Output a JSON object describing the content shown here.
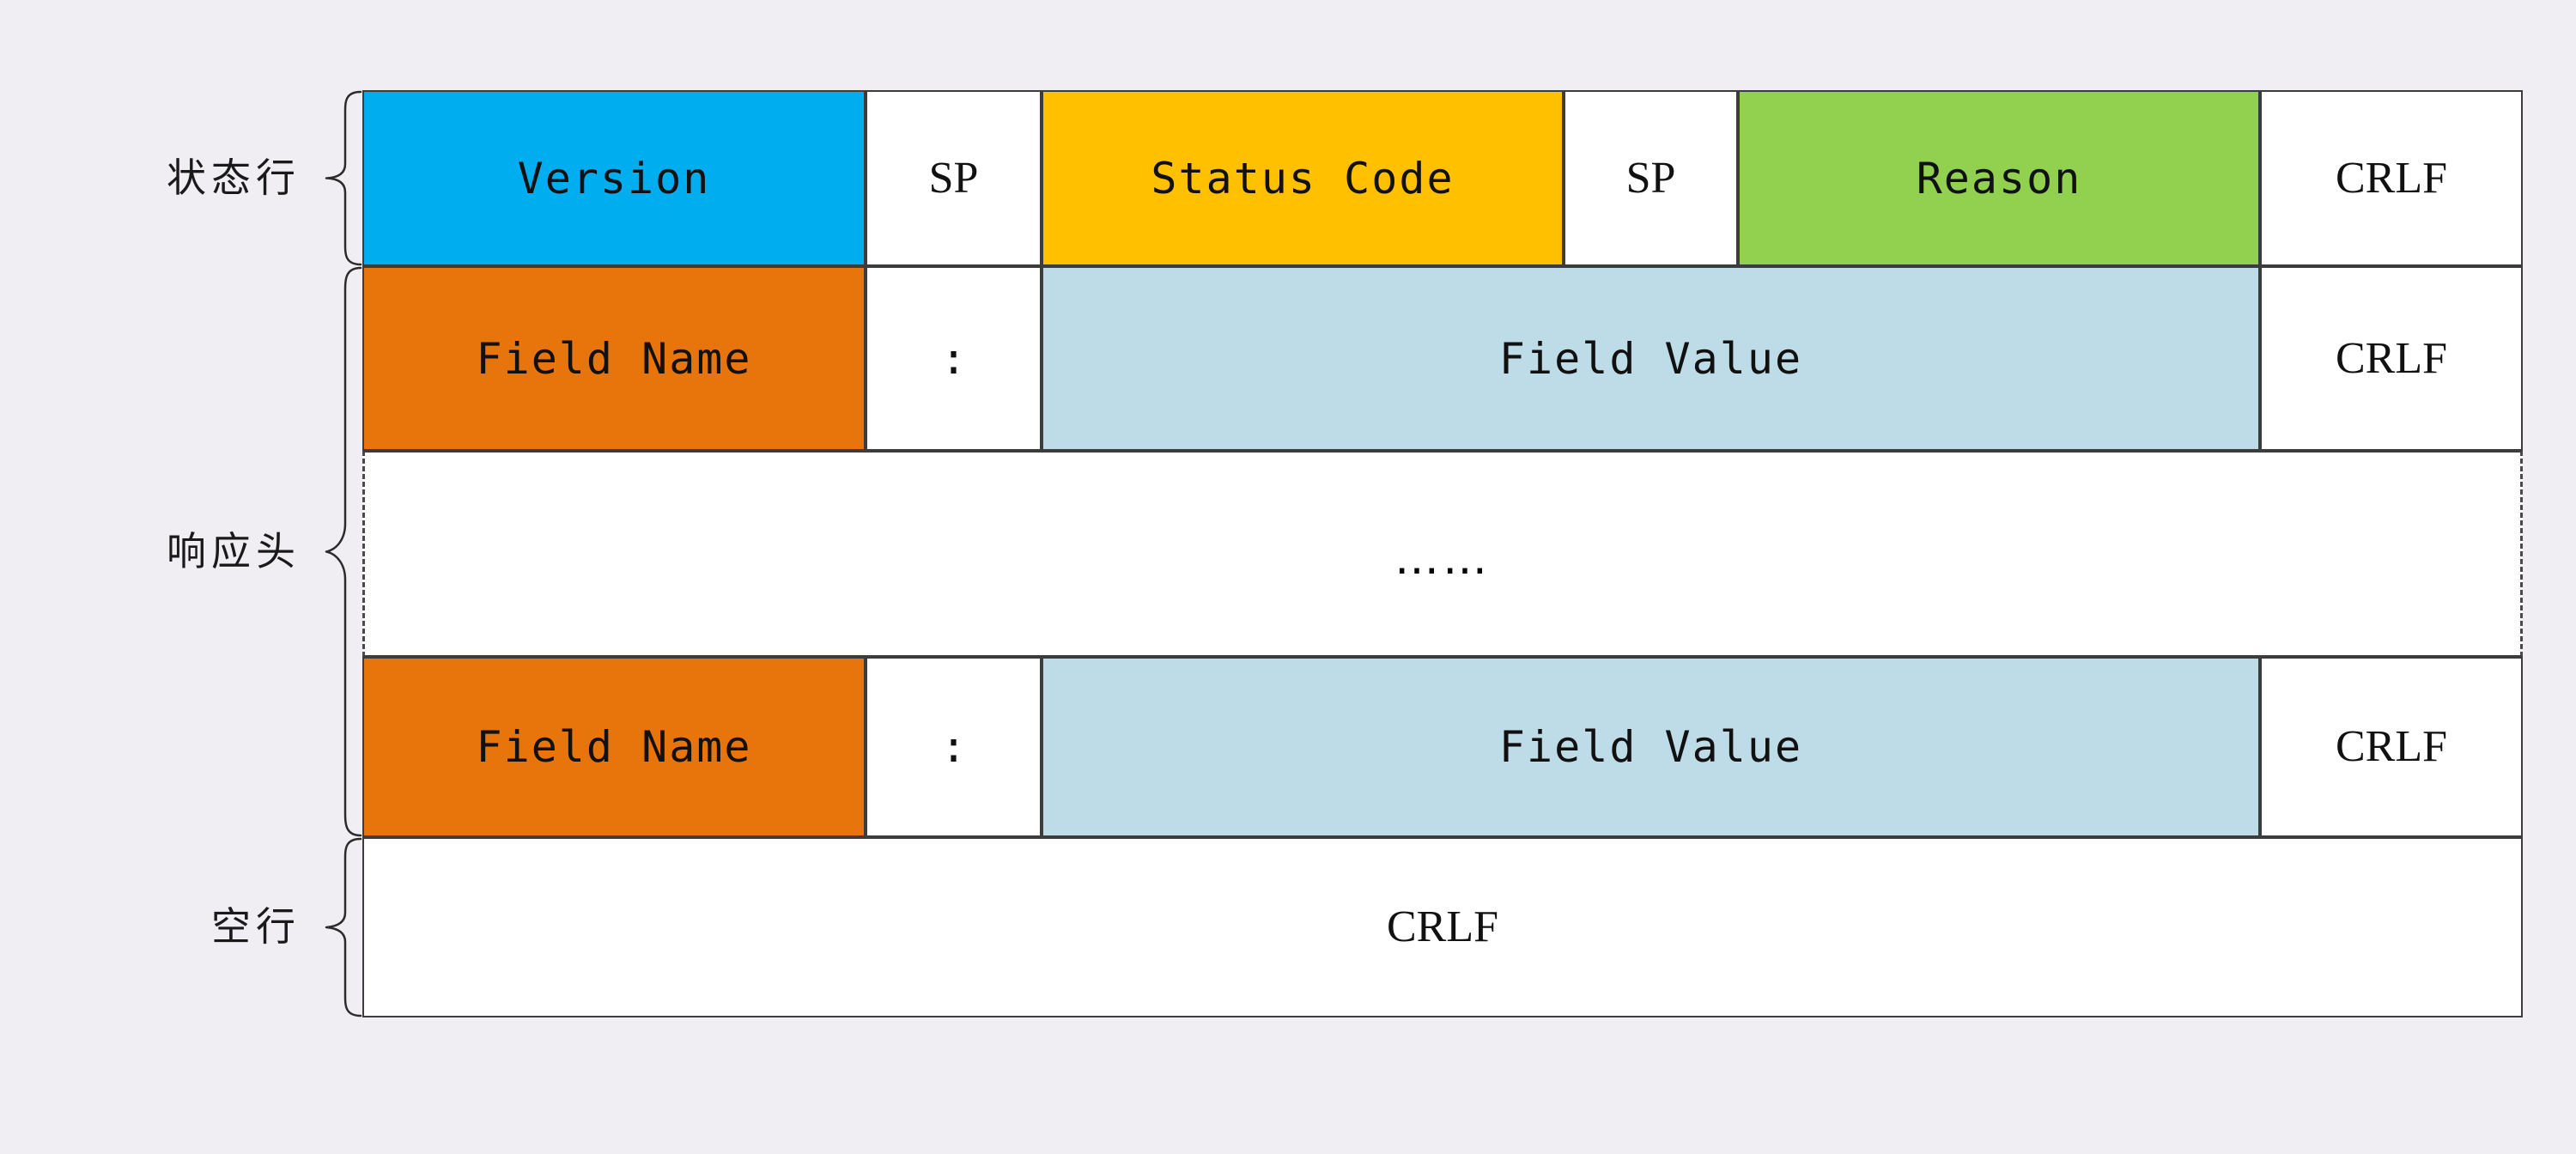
{
  "background_color": "#f0eef2",
  "colors": {
    "version": "#00aeef",
    "status_code": "#ffc000",
    "reason": "#92d050",
    "field_name": "#e8740c",
    "field_value": "#bddce8",
    "white": "#ffffff",
    "border": "#3c3c3c"
  },
  "groups": [
    {
      "label": "状态行"
    },
    {
      "label": "响应头"
    },
    {
      "label": "空行"
    }
  ],
  "rows": [
    {
      "name": "status-line",
      "cells": [
        {
          "text": "Version",
          "style": "version"
        },
        {
          "text": "SP",
          "style": "white"
        },
        {
          "text": "Status Code",
          "style": "status_code"
        },
        {
          "text": "SP",
          "style": "white"
        },
        {
          "text": "Reason",
          "style": "reason"
        },
        {
          "text": "CRLF",
          "style": "white"
        }
      ]
    },
    {
      "name": "header-line-first",
      "cells": [
        {
          "text": "Field Name",
          "style": "field_name"
        },
        {
          "text": ":",
          "style": "white"
        },
        {
          "text": "Field Value",
          "style": "field_value"
        },
        {
          "text": "CRLF",
          "style": "white"
        }
      ]
    },
    {
      "name": "header-ellipsis",
      "cells": [
        {
          "text": "……",
          "style": "white"
        }
      ]
    },
    {
      "name": "header-line-last",
      "cells": [
        {
          "text": "Field Name",
          "style": "field_name"
        },
        {
          "text": ":",
          "style": "white"
        },
        {
          "text": "Field Value",
          "style": "field_value"
        },
        {
          "text": "CRLF",
          "style": "white"
        }
      ]
    },
    {
      "name": "blank-line",
      "cells": [
        {
          "text": "CRLF",
          "style": "white"
        }
      ]
    }
  ]
}
